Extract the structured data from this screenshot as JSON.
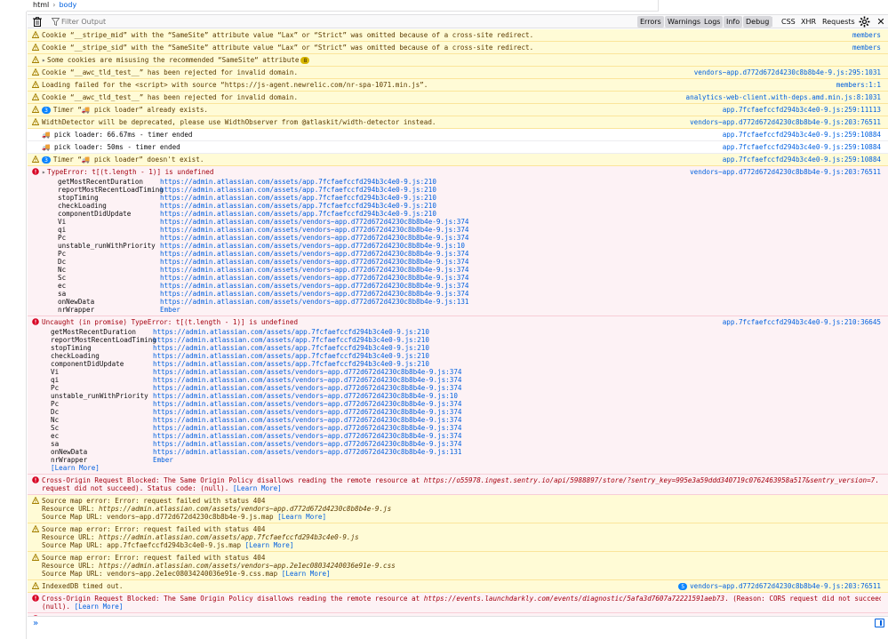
{
  "breadcrumb": {
    "html": "html",
    "body": "body"
  },
  "toolbar": {
    "filter_placeholder": "Filter Output",
    "levels": [
      "Errors",
      "Warnings",
      "Logs",
      "Info",
      "Debug"
    ],
    "kinds": [
      "CSS",
      "XHR",
      "Requests"
    ]
  },
  "messages": [
    {
      "type": "warn",
      "text": "Cookie “__stripe_mid” with the “SameSite” attribute value “Lax” or “Strict” was omitted because of a cross-site redirect.",
      "src": "members"
    },
    {
      "type": "warn",
      "text": "Cookie “__stripe_sid” with the “SameSite” attribute value “Lax” or “Strict” was omitted because of a cross-site redirect.",
      "src": "members"
    },
    {
      "type": "warn",
      "text": "Some cookies are misusing the recommended “SameSite“ attribute",
      "count": "8",
      "src": ""
    },
    {
      "type": "warn",
      "text": "Cookie “__awc_tld_test__” has been rejected for invalid domain.",
      "src": "vendors~app.d772d672d4230c8b8b4e-9.js:295:1031"
    },
    {
      "type": "warn",
      "text": "Loading failed for the <script> with source “https://js-agent.newrelic.com/nr-spa-1071.min.js”.",
      "src": "members:1:1"
    },
    {
      "type": "warn",
      "text": "Cookie “__awc_tld_test__” has been rejected for invalid domain.",
      "src": "analytics-web-client.with-deps.amd.min.js:8:1031"
    },
    {
      "type": "warn",
      "text": "Timer “🚚 pick loader” already exists.",
      "badge": "3",
      "src": "app.7fcfaefccfd294b3c4e0-9.js:259:11113"
    },
    {
      "type": "warn",
      "text": "WidthDetector will be deprecated, please use WidthObserver from @atlaskit/width-detector instead.",
      "src": "vendors~app.d772d672d4230c8b8b4e-9.js:203:76511"
    },
    {
      "type": "log",
      "text": "🚚 pick loader: 66.67ms - timer ended",
      "src": "app.7fcfaefccfd294b3c4e0-9.js:259:10884"
    },
    {
      "type": "log",
      "text": "🚚 pick loader: 50ms - timer ended",
      "src": "app.7fcfaefccfd294b3c4e0-9.js:259:10884"
    },
    {
      "type": "warn",
      "text": "Timer “🚚 pick loader” doesn't exist.",
      "badge": "3",
      "src": "app.7fcfaefccfd294b3c4e0-9.js:259:10884"
    }
  ],
  "error1": {
    "text": "TypeError: t[(t.length - 1)] is undefined",
    "src": "vendors~app.d772d672d4230c8b8b4e-9.js:203:76511",
    "trace": [
      [
        "getMostRecentDuration",
        "https://admin.atlassian.com/assets/app.7fcfaefccfd294b3c4e0-9.js:210"
      ],
      [
        "reportMostRecentLoadTiming",
        "https://admin.atlassian.com/assets/app.7fcfaefccfd294b3c4e0-9.js:210"
      ],
      [
        "stopTiming",
        "https://admin.atlassian.com/assets/app.7fcfaefccfd294b3c4e0-9.js:210"
      ],
      [
        "checkLoading",
        "https://admin.atlassian.com/assets/app.7fcfaefccfd294b3c4e0-9.js:210"
      ],
      [
        "componentDidUpdate",
        "https://admin.atlassian.com/assets/app.7fcfaefccfd294b3c4e0-9.js:210"
      ],
      [
        "Vi",
        "https://admin.atlassian.com/assets/vendors~app.d772d672d4230c8b8b4e-9.js:374"
      ],
      [
        "qi",
        "https://admin.atlassian.com/assets/vendors~app.d772d672d4230c8b8b4e-9.js:374"
      ],
      [
        "Pc",
        "https://admin.atlassian.com/assets/vendors~app.d772d672d4230c8b8b4e-9.js:374"
      ],
      [
        "unstable_runWithPriority",
        "https://admin.atlassian.com/assets/vendors~app.d772d672d4230c8b8b4e-9.js:10"
      ],
      [
        "Pc",
        "https://admin.atlassian.com/assets/vendors~app.d772d672d4230c8b8b4e-9.js:374"
      ],
      [
        "Dc",
        "https://admin.atlassian.com/assets/vendors~app.d772d672d4230c8b8b4e-9.js:374"
      ],
      [
        "Nc",
        "https://admin.atlassian.com/assets/vendors~app.d772d672d4230c8b8b4e-9.js:374"
      ],
      [
        "Sc",
        "https://admin.atlassian.com/assets/vendors~app.d772d672d4230c8b8b4e-9.js:374"
      ],
      [
        "ec",
        "https://admin.atlassian.com/assets/vendors~app.d772d672d4230c8b8b4e-9.js:374"
      ],
      [
        "sa",
        "https://admin.atlassian.com/assets/vendors~app.d772d672d4230c8b8b4e-9.js:374"
      ],
      [
        "onNewData",
        "https://admin.atlassian.com/assets/vendors~app.d772d672d4230c8b8b4e-9.js:131"
      ],
      [
        "nrWrapper",
        "Ember"
      ]
    ]
  },
  "error2": {
    "text": "Uncaught (in promise) TypeError: t[(t.length - 1)] is undefined",
    "src": "app.7fcfaefccfd294b3c4e0-9.js:210:36645",
    "learn": "[Learn More]",
    "trace": [
      [
        "getMostRecentDuration",
        "https://admin.atlassian.com/assets/app.7fcfaefccfd294b3c4e0-9.js:210"
      ],
      [
        "reportMostRecentLoadTiming",
        "https://admin.atlassian.com/assets/app.7fcfaefccfd294b3c4e0-9.js:210"
      ],
      [
        "stopTiming",
        "https://admin.atlassian.com/assets/app.7fcfaefccfd294b3c4e0-9.js:210"
      ],
      [
        "checkLoading",
        "https://admin.atlassian.com/assets/app.7fcfaefccfd294b3c4e0-9.js:210"
      ],
      [
        "componentDidUpdate",
        "https://admin.atlassian.com/assets/app.7fcfaefccfd294b3c4e0-9.js:210"
      ],
      [
        "Vi",
        "https://admin.atlassian.com/assets/vendors~app.d772d672d4230c8b8b4e-9.js:374"
      ],
      [
        "qi",
        "https://admin.atlassian.com/assets/vendors~app.d772d672d4230c8b8b4e-9.js:374"
      ],
      [
        "Pc",
        "https://admin.atlassian.com/assets/vendors~app.d772d672d4230c8b8b4e-9.js:374"
      ],
      [
        "unstable_runWithPriority",
        "https://admin.atlassian.com/assets/vendors~app.d772d672d4230c8b8b4e-9.js:10"
      ],
      [
        "Pc",
        "https://admin.atlassian.com/assets/vendors~app.d772d672d4230c8b8b4e-9.js:374"
      ],
      [
        "Dc",
        "https://admin.atlassian.com/assets/vendors~app.d772d672d4230c8b8b4e-9.js:374"
      ],
      [
        "Nc",
        "https://admin.atlassian.com/assets/vendors~app.d772d672d4230c8b8b4e-9.js:374"
      ],
      [
        "Sc",
        "https://admin.atlassian.com/assets/vendors~app.d772d672d4230c8b8b4e-9.js:374"
      ],
      [
        "ec",
        "https://admin.atlassian.com/assets/vendors~app.d772d672d4230c8b8b4e-9.js:374"
      ],
      [
        "sa",
        "https://admin.atlassian.com/assets/vendors~app.d772d672d4230c8b8b4e-9.js:374"
      ],
      [
        "onNewData",
        "https://admin.atlassian.com/assets/vendors~app.d772d672d4230c8b8b4e-9.js:131"
      ],
      [
        "nrWrapper",
        "Ember"
      ]
    ]
  },
  "cors1": {
    "line1_a": "Cross-Origin Request Blocked: The Same Origin Policy disallows reading the remote resource at ",
    "url": "https://o55978.ingest.sentry.io/api/5988897/store/?sentry_key=995e3a59ddd340719c0762463958a517&sentry_version=7",
    "line1_b": ". (Reason: CORS",
    "line2": "request did not succeed). Status code: (null). ",
    "learn": "[Learn More]"
  },
  "srcmap": [
    {
      "l1": "Source map error: Error: request failed with status 404",
      "l2a": "Resource URL: ",
      "l2b": "https://admin.atlassian.com/assets/vendors~app.d772d672d4230c8b8b4e-9.js",
      "l3": "Source Map URL: vendors~app.d772d672d4230c8b8b4e-9.js.map ",
      "learn": "[Learn More]"
    },
    {
      "l1": "Source map error: Error: request failed with status 404",
      "l2a": "Resource URL: ",
      "l2b": "https://admin.atlassian.com/assets/app.7fcfaefccfd294b3c4e0-9.js",
      "l3": "Source Map URL: app.7fcfaefccfd294b3c4e0-9.js.map ",
      "learn": "[Learn More]"
    },
    {
      "l1": "Source map error: Error: request failed with status 404",
      "l2a": "Resource URL: ",
      "l2b": "https://admin.atlassian.com/assets/vendors~app.2e1ec08034240036e91e-9.css",
      "l3": "Source Map URL: vendors~app.2e1ec08034240036e91e-9.css.map ",
      "learn": "[Learn More]"
    }
  ],
  "indexeddb": {
    "text": "IndexedDB timed out.",
    "badge": "5",
    "src": "vendors~app.d772d672d4230c8b8b4e-9.js:203:76511"
  },
  "cors_ld": [
    {
      "a": "Cross-Origin Request Blocked: The Same Origin Policy disallows reading the remote resource at ",
      "url": "https://events.launchdarkly.com/events/diagnostic/5afa3d7607a72221591aeb73",
      "b": ". (Reason: CORS request did not succeed). Status code:",
      "c": "(null). ",
      "learn": "[Learn More]"
    },
    {
      "a": "Cross-Origin Request Blocked: The Same Origin Policy disallows reading the remote resource at ",
      "url": "https://events.launchdarkly.com/events/diagnostic/5afa3d7607a72221591aeb73",
      "b": ". (Reason: CORS request did not succeed). Status code:",
      "c": "(null). ",
      "learn": "[Learn More]"
    }
  ],
  "prompt": {
    "symbol": "»"
  }
}
